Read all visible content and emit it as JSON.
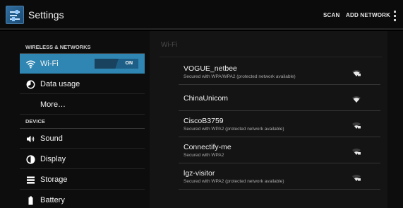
{
  "actionbar": {
    "title": "Settings",
    "scan_label": "SCAN",
    "add_network_label": "ADD NETWORK"
  },
  "sidebar": {
    "sections": [
      {
        "header": "WIRELESS & NETWORKS"
      },
      {
        "header": "DEVICE"
      }
    ],
    "items": [
      {
        "label": "Wi-Fi",
        "icon": "wifi-icon",
        "selected": true,
        "toggle": "ON"
      },
      {
        "label": "Data usage",
        "icon": "data-usage-icon"
      },
      {
        "label": "More…",
        "icon": ""
      },
      {
        "label": "Sound",
        "icon": "speaker-icon"
      },
      {
        "label": "Display",
        "icon": "brightness-icon"
      },
      {
        "label": "Storage",
        "icon": "storage-icon"
      },
      {
        "label": "Battery",
        "icon": "battery-icon"
      }
    ]
  },
  "wifi": {
    "header": "Wi-Fi",
    "networks": [
      {
        "name": "VOGUE_netbee",
        "status": "Secured with WPA/WPA2 (protected network available)",
        "secured": true
      },
      {
        "name": "ChinaUnicom",
        "status": "",
        "secured": false
      },
      {
        "name": "CiscoB3759",
        "status": "Secured with WPA2 (protected network available)",
        "secured": true
      },
      {
        "name": "Connectify-me",
        "status": "Secured with WPA2",
        "secured": true
      },
      {
        "name": "lgz-visitor",
        "status": "Secured with WPA2 (protected network available)",
        "secured": true
      }
    ]
  },
  "colors": {
    "accent": "#2f86b2",
    "background": "#0d0d0d",
    "panel": "#141414"
  }
}
